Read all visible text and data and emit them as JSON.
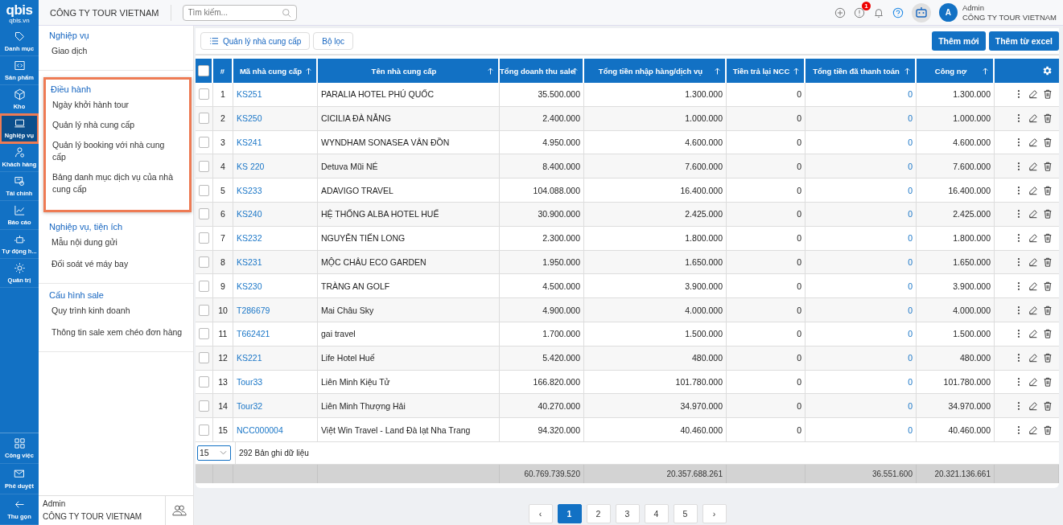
{
  "topbar": {
    "logo": "qbis",
    "logo_sub": "qbis.vn",
    "company": "CÔNG TY TOUR VIETNAM",
    "search": {
      "placeholder": "Tìm kiếm..."
    },
    "alert_badge": "1",
    "avatar": "A",
    "user": "Admin",
    "user_company": "CÔNG TY TOUR VIETNAM"
  },
  "rail": {
    "items": [
      {
        "label": "Danh mục",
        "selected": false,
        "highlighted": false
      },
      {
        "label": "Sản phẩm",
        "selected": false,
        "highlighted": false
      },
      {
        "label": "Kho",
        "selected": false,
        "highlighted": false
      },
      {
        "label": "Nghiệp vụ",
        "selected": true,
        "highlighted": true
      },
      {
        "label": "Khách hàng",
        "selected": false,
        "highlighted": false
      },
      {
        "label": "Tài chính",
        "selected": false,
        "highlighted": false
      },
      {
        "label": "Báo cáo",
        "selected": false,
        "highlighted": false
      },
      {
        "label": "Tự động h...",
        "selected": false,
        "highlighted": false
      },
      {
        "label": "Quản trị",
        "selected": false,
        "highlighted": false
      }
    ],
    "bottom": [
      {
        "label": "Công việc"
      },
      {
        "label": "Phê duyệt"
      },
      {
        "label": "Thu gọn"
      }
    ]
  },
  "sidebar": {
    "sections": [
      {
        "title": "Nghiệp vụ",
        "highlighted": false,
        "items": [
          "Giao dịch"
        ]
      },
      {
        "title": "Điều hành",
        "highlighted": true,
        "items": [
          "Ngày khởi hành tour",
          "Quản lý nhà cung cấp",
          "Quản lý booking với nhà cung cấp",
          "Bảng danh mục dịch vụ của nhà cung cấp"
        ]
      },
      {
        "title": "Nghiệp vụ, tiện ích",
        "highlighted": false,
        "items": [
          "Mẫu nội dung gửi",
          "Đối soát vé máy bay"
        ]
      },
      {
        "title": "Cấu hình sale",
        "highlighted": false,
        "items": [
          "Quy trình kinh doanh",
          "Thông tin sale xem chéo đơn hàng"
        ]
      }
    ],
    "footer": {
      "user": "Admin",
      "company": "CÔNG TY TOUR VIETNAM"
    }
  },
  "toolbar": {
    "left": [
      "Quản lý nhà cung cấp",
      "Bộ lọc"
    ],
    "right": [
      "Thêm mới",
      "Thêm từ excel"
    ]
  },
  "table": {
    "all_checked": false,
    "columns": [
      "#",
      "Mã nhà cung cấp",
      "Tên nhà cung cấp",
      "Tổng doanh thu sale",
      "Tổng tiền nhập hàng/dịch vụ",
      "Tiền trả lại NCC",
      "Tổng tiền đã thanh toán",
      "Công nợ"
    ],
    "rows": [
      {
        "checked": false,
        "no": "1",
        "code": "KS251",
        "name": "PARALIA HOTEL PHÚ QUỐC",
        "sale": "35.500.000",
        "import": "1.300.000",
        "refund": "0",
        "paid": "0",
        "debt": "1.300.000"
      },
      {
        "checked": false,
        "no": "2",
        "code": "KS250",
        "name": "CICILIA ĐÀ NẴNG",
        "sale": "2.400.000",
        "import": "1.000.000",
        "refund": "0",
        "paid": "0",
        "debt": "1.000.000"
      },
      {
        "checked": false,
        "no": "3",
        "code": "KS241",
        "name": "WYNDHAM SONASEA VÂN ĐỒN",
        "sale": "4.950.000",
        "import": "4.600.000",
        "refund": "0",
        "paid": "0",
        "debt": "4.600.000"
      },
      {
        "checked": false,
        "no": "4",
        "code": "KS 220",
        "name": "Detuva Mũi NÉ",
        "sale": "8.400.000",
        "import": "7.600.000",
        "refund": "0",
        "paid": "0",
        "debt": "7.600.000"
      },
      {
        "checked": false,
        "no": "5",
        "code": "KS233",
        "name": "ADAVIGO TRAVEL",
        "sale": "104.088.000",
        "import": "16.400.000",
        "refund": "0",
        "paid": "0",
        "debt": "16.400.000"
      },
      {
        "checked": false,
        "no": "6",
        "code": "KS240",
        "name": "HỆ THỐNG ALBA HOTEL HUẾ",
        "sale": "30.900.000",
        "import": "2.425.000",
        "refund": "0",
        "paid": "0",
        "debt": "2.425.000"
      },
      {
        "checked": false,
        "no": "7",
        "code": "KS232",
        "name": "NGUYỄN TIẾN LONG",
        "sale": "2.300.000",
        "import": "1.800.000",
        "refund": "0",
        "paid": "0",
        "debt": "1.800.000"
      },
      {
        "checked": false,
        "no": "8",
        "code": "KS231",
        "name": "MỘC CHÂU ECO GARDEN",
        "sale": "1.950.000",
        "import": "1.650.000",
        "refund": "0",
        "paid": "0",
        "debt": "1.650.000"
      },
      {
        "checked": false,
        "no": "9",
        "code": "KS230",
        "name": "TRÀNG AN GOLF",
        "sale": "4.500.000",
        "import": "3.900.000",
        "refund": "0",
        "paid": "0",
        "debt": "3.900.000"
      },
      {
        "checked": false,
        "no": "10",
        "code": "T286679",
        "name": "Mai Châu Sky",
        "sale": "4.900.000",
        "import": "4.000.000",
        "refund": "0",
        "paid": "0",
        "debt": "4.000.000"
      },
      {
        "checked": false,
        "no": "11",
        "code": "T662421",
        "name": "gai travel",
        "sale": "1.700.000",
        "import": "1.500.000",
        "refund": "0",
        "paid": "0",
        "debt": "1.500.000"
      },
      {
        "checked": false,
        "no": "12",
        "code": "KS221",
        "name": "Life Hotel Huế",
        "sale": "5.420.000",
        "import": "480.000",
        "refund": "0",
        "paid": "0",
        "debt": "480.000"
      },
      {
        "checked": false,
        "no": "13",
        "code": "Tour33",
        "name": "Liên Minh Kiệu Tử",
        "sale": "166.820.000",
        "import": "101.780.000",
        "refund": "0",
        "paid": "0",
        "debt": "101.780.000"
      },
      {
        "checked": false,
        "no": "14",
        "code": "Tour32",
        "name": "Liên Minh Thượng Hải",
        "sale": "40.270.000",
        "import": "34.970.000",
        "refund": "0",
        "paid": "0",
        "debt": "34.970.000"
      },
      {
        "checked": false,
        "no": "15",
        "code": "NCC000004",
        "name": "Việt Win Travel - Land Đà lạt Nha Trang",
        "sale": "94.320.000",
        "import": "40.460.000",
        "refund": "0",
        "paid": "0",
        "debt": "40.460.000"
      }
    ],
    "page_size": "15",
    "record_count": "292 Bản ghi dữ liệu",
    "totals": {
      "sale": "60.769.739.520",
      "import": "20.357.688.261",
      "paid": "36.551.600",
      "debt": "20.321.136.661"
    }
  },
  "pagination": {
    "prev": "‹",
    "next": "›",
    "pages": [
      {
        "label": "1",
        "selected": true
      },
      {
        "label": "2",
        "selected": false
      },
      {
        "label": "3",
        "selected": false
      },
      {
        "label": "4",
        "selected": false
      },
      {
        "label": "5",
        "selected": false
      }
    ]
  }
}
